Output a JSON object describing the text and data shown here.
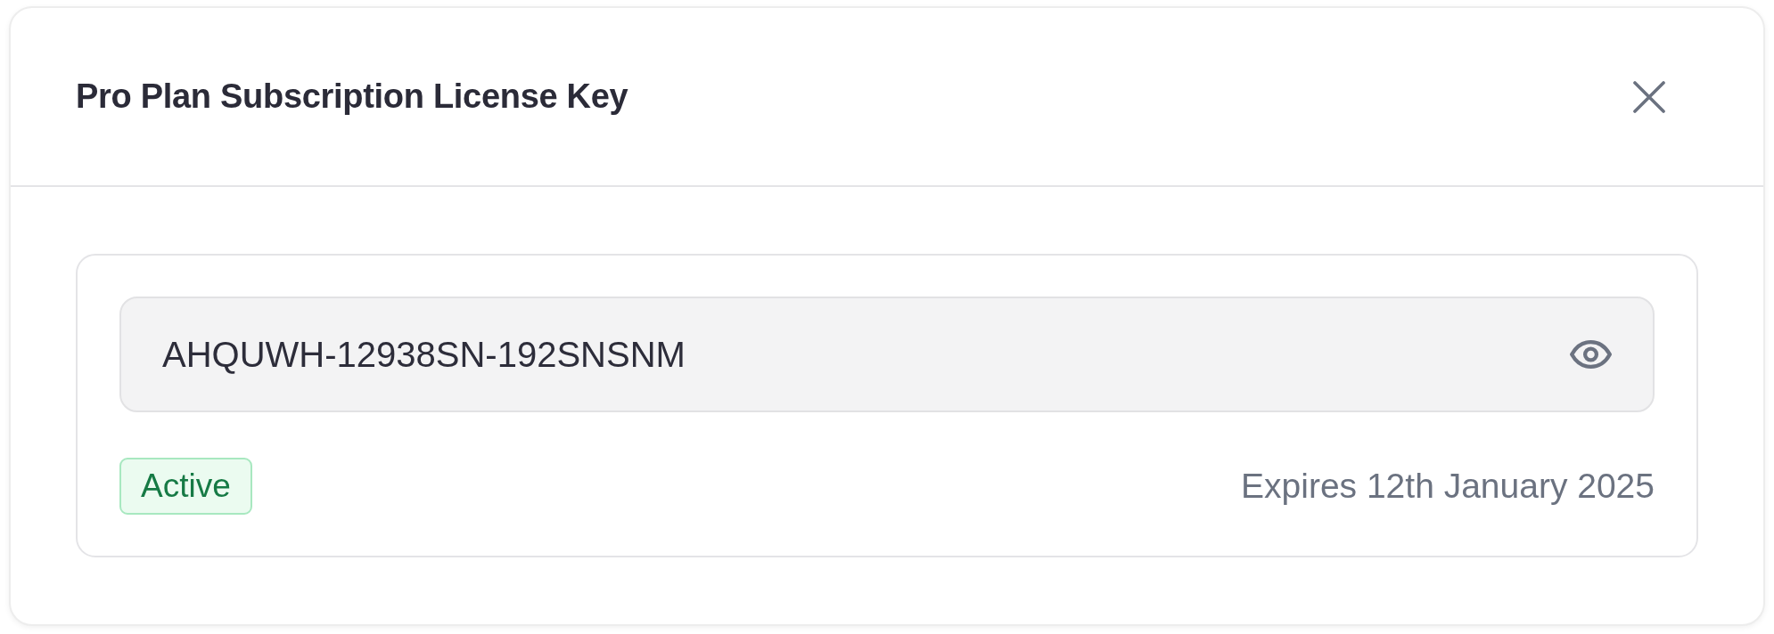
{
  "dialog": {
    "title": "Pro Plan Subscription License Key",
    "license_key": {
      "value": "AHQUWH-12938SN-192SNSNM"
    },
    "status_badge": {
      "label": "Active"
    },
    "expiry": "Expires 12th January 2025"
  }
}
